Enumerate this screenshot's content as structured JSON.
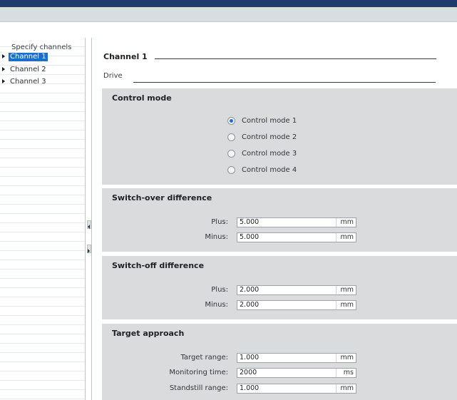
{
  "tree": {
    "header": "Specify channels",
    "items": [
      {
        "label": "Channel 1",
        "selected": true
      },
      {
        "label": "Channel 2",
        "selected": false
      },
      {
        "label": "Channel 3",
        "selected": false
      }
    ]
  },
  "section": {
    "title": "Channel 1",
    "subtitle": "Drive"
  },
  "control_mode": {
    "title": "Control mode",
    "options": [
      {
        "label": "Control mode 1",
        "checked": true
      },
      {
        "label": "Control mode 2",
        "checked": false
      },
      {
        "label": "Control mode 3",
        "checked": false
      },
      {
        "label": "Control mode 4",
        "checked": false
      }
    ]
  },
  "switch_over": {
    "title": "Switch-over difference",
    "fields": [
      {
        "label": "Plus:",
        "value": "5.000",
        "unit": "mm"
      },
      {
        "label": "Minus:",
        "value": "5.000",
        "unit": "mm"
      }
    ]
  },
  "switch_off": {
    "title": "Switch-off difference",
    "fields": [
      {
        "label": "Plus:",
        "value": "2.000",
        "unit": "mm"
      },
      {
        "label": "Minus:",
        "value": "2.000",
        "unit": "mm"
      }
    ]
  },
  "target_approach": {
    "title": "Target approach",
    "fields": [
      {
        "label": "Target range:",
        "value": "1.000",
        "unit": "mm"
      },
      {
        "label": "Monitoring time:",
        "value": "2000",
        "unit": "ms"
      },
      {
        "label": "Standstill range:",
        "value": "1.000",
        "unit": "mm"
      }
    ]
  },
  "colors": {
    "selection": "#1a6fc9",
    "group_bg": "#d9dbdd",
    "titlebar": "#1f3a6c"
  }
}
